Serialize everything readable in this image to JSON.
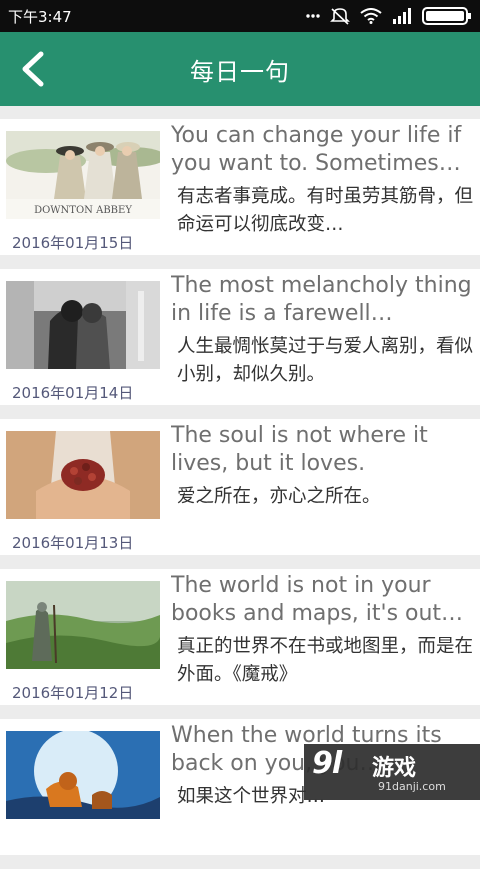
{
  "status_bar": {
    "time": "下午3:47"
  },
  "header": {
    "title": "每日一句"
  },
  "items": [
    {
      "en": "You can change your life if you want to. Sometimes…",
      "cn": "有志者事竟成。有时虽劳其筋骨，但命运可以彻底改变…",
      "date": "2016年01月15日",
      "thumb_caption": "DOWNTON ABBEY"
    },
    {
      "en": "The most melancholy thing in life is a farewell betwee…",
      "cn": "人生最惆怅莫过于与爱人离别，看似小别，却似久别。",
      "date": "2016年01月14日"
    },
    {
      "en": "The soul is not where it lives, but it loves.",
      "cn": "爱之所在，亦心之所在。",
      "date": "2016年01月13日"
    },
    {
      "en": "The world is not in your books and maps, it's out…",
      "cn": "真正的世界不在书或地图里，而是在外面。《魔戒》",
      "date": "2016年01月12日"
    },
    {
      "en": "When the world turns its back on you, you…",
      "cn": "如果这个世界对…",
      "date": ""
    }
  ],
  "watermark": {
    "logo": "9l",
    "name": "游戏",
    "url": "91danji.com"
  }
}
